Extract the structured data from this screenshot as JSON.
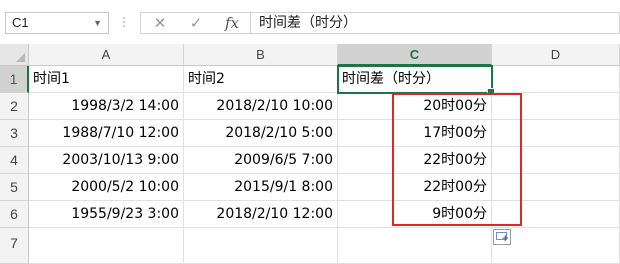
{
  "formula_bar": {
    "name_box": "C1",
    "cancel_icon": "✕",
    "enter_icon": "✓",
    "fx_label": "fx",
    "content": "时间差（时分）"
  },
  "columns": [
    "A",
    "B",
    "C",
    "D"
  ],
  "rows": [
    "1",
    "2",
    "3",
    "4",
    "5",
    "6",
    "7"
  ],
  "header_row": {
    "a": "时间1",
    "b": "时间2",
    "c": "时间差（时分）"
  },
  "data_rows": [
    {
      "a": "1998/3/2 14:00",
      "b": "2018/2/10 10:00",
      "c": "20时00分"
    },
    {
      "a": "1988/7/10 12:00",
      "b": "2018/2/10 5:00",
      "c": "17时00分"
    },
    {
      "a": "2003/10/13 9:00",
      "b": "2009/6/5 7:00",
      "c": "22时00分"
    },
    {
      "a": "2000/5/2 10:00",
      "b": "2015/9/1 8:00",
      "c": "22时00分"
    },
    {
      "a": "1955/9/23 3:00",
      "b": "2018/2/10 12:00",
      "c": "9时00分"
    }
  ],
  "colors": {
    "selection_green": "#217346",
    "highlight_red": "#e0262b"
  }
}
